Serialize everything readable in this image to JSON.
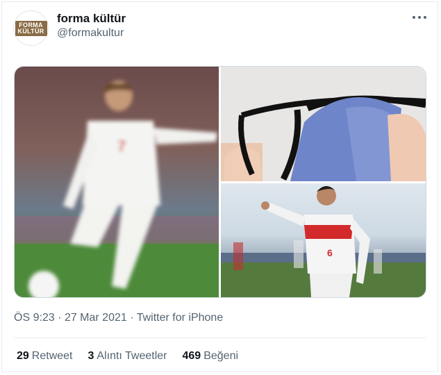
{
  "tweet": {
    "display_name": "forma kültür",
    "handle": "@formakultur",
    "avatar_logo": {
      "line1": "FORMA",
      "line2": "KÜLTÜR"
    },
    "time": "ÖS 9:23",
    "separator": "·",
    "date": "27 Mar 2021",
    "source": "Twitter for iPhone"
  },
  "media": {
    "player_left_number": "7",
    "player_right_number": "6"
  },
  "stats": [
    {
      "count": "29",
      "label": "Retweet"
    },
    {
      "count": "3",
      "label": "Alıntı Tweetler"
    },
    {
      "count": "469",
      "label": "Beğeni"
    }
  ],
  "colors": {
    "brand_logo": "#8a6b45",
    "secondary_text": "#536471",
    "primary_text": "#0f1419",
    "border": "#e6ecf0"
  }
}
